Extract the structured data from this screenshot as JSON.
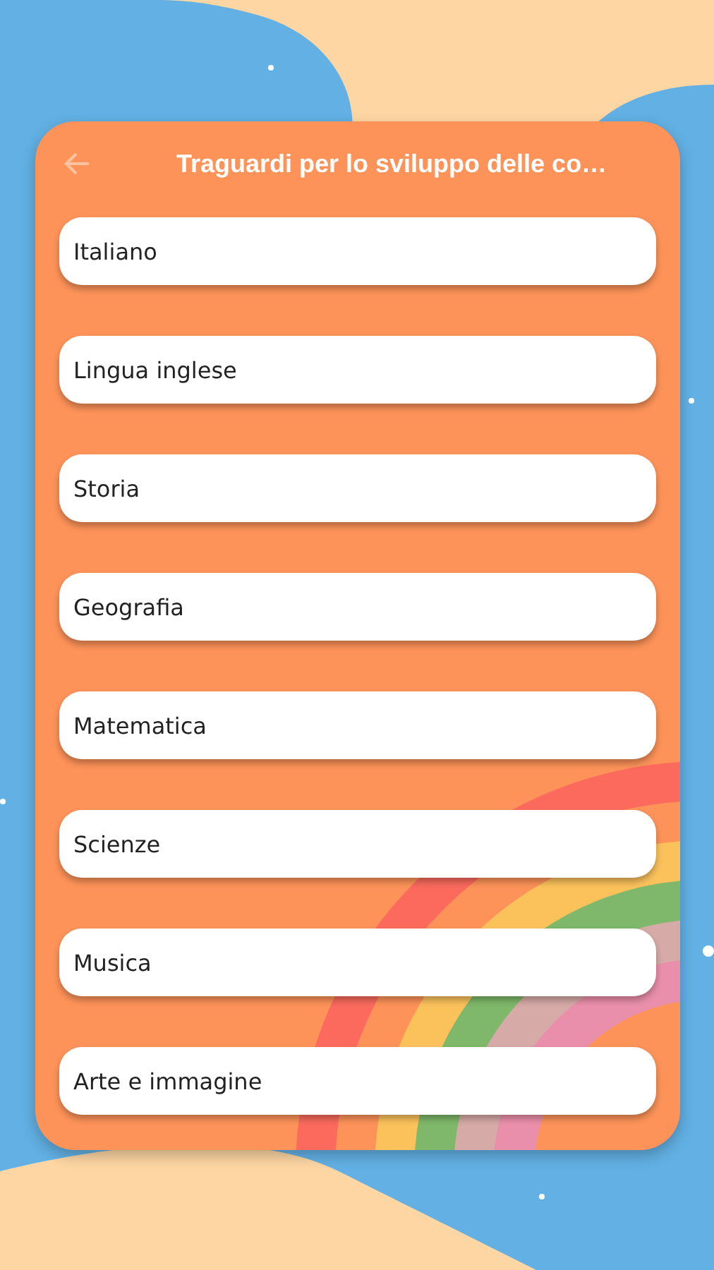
{
  "app_bar": {
    "title": "Traguardi per lo sviluppo delle co…"
  },
  "subjects": [
    {
      "label": "Italiano"
    },
    {
      "label": "Lingua inglese"
    },
    {
      "label": "Storia"
    },
    {
      "label": "Geografia"
    },
    {
      "label": "Matematica"
    },
    {
      "label": "Scienze"
    },
    {
      "label": "Musica"
    },
    {
      "label": "Arte e immagine"
    }
  ]
}
